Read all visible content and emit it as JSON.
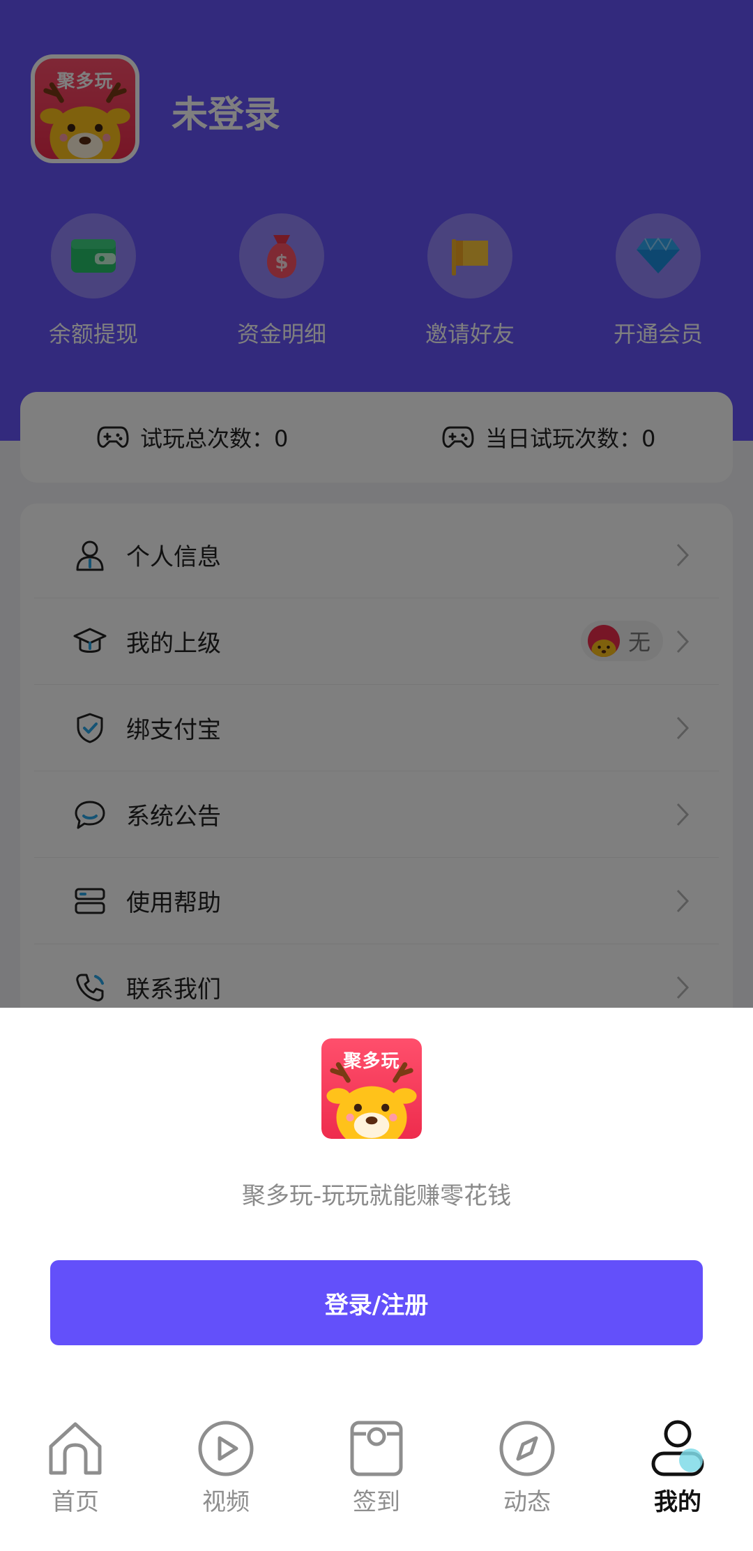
{
  "app": {
    "logo_text": "聚多玩"
  },
  "header": {
    "username": "未登录",
    "accent_color": "#6654fb",
    "quick_actions": [
      {
        "label": "余额提现",
        "icon": "wallet-icon"
      },
      {
        "label": "资金明细",
        "icon": "money-bag-icon"
      },
      {
        "label": "邀请好友",
        "icon": "flag-icon"
      },
      {
        "label": "开通会员",
        "icon": "diamond-icon"
      }
    ]
  },
  "stats": {
    "total_trials_label": "试玩总次数：0",
    "today_trials_label": "当日试玩次数：0"
  },
  "menu": {
    "items": [
      {
        "label": "个人信息",
        "icon": "user-icon"
      },
      {
        "label": "我的上级",
        "icon": "graduation-cap-icon",
        "value": "无"
      },
      {
        "label": "绑支付宝",
        "icon": "shield-check-icon"
      },
      {
        "label": "系统公告",
        "icon": "chat-bubble-icon"
      },
      {
        "label": "使用帮助",
        "icon": "server-stack-icon"
      },
      {
        "label": "联系我们",
        "icon": "phone-icon"
      }
    ]
  },
  "sheet": {
    "tagline": "聚多玩-玩玩就能赚零花钱",
    "login_button": "登录/注册",
    "button_color": "#6350fa"
  },
  "tabbar": {
    "tabs": [
      {
        "label": "首页",
        "icon": "home-icon"
      },
      {
        "label": "视频",
        "icon": "play-icon"
      },
      {
        "label": "签到",
        "icon": "checkin-icon"
      },
      {
        "label": "动态",
        "icon": "compass-icon"
      },
      {
        "label": "我的",
        "icon": "profile-icon",
        "active": true
      }
    ]
  }
}
